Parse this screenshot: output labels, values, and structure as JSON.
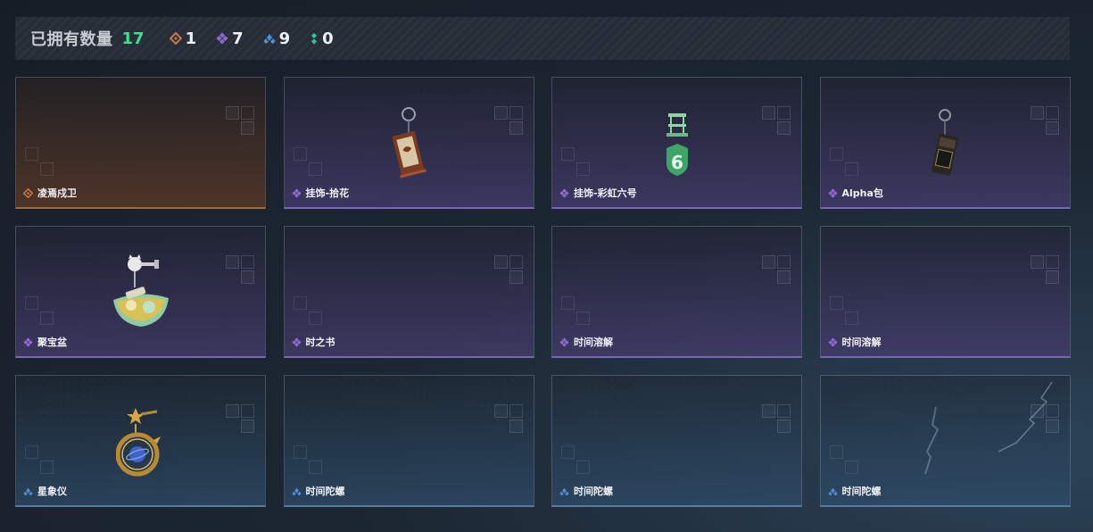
{
  "header": {
    "label": "已拥有数量",
    "total": "17",
    "counts": [
      {
        "rarity": "orange",
        "icon": "orange-diamond-icon",
        "color": "#c9764a",
        "value": "1"
      },
      {
        "rarity": "purple",
        "icon": "purple-cluster-icon",
        "color": "#8f6ad4",
        "value": "7"
      },
      {
        "rarity": "blue",
        "icon": "blue-triangle-icon",
        "color": "#4f8fd6",
        "value": "9"
      },
      {
        "rarity": "green",
        "icon": "green-dots-icon",
        "color": "#37c79a",
        "value": "0"
      }
    ]
  },
  "items": [
    {
      "name": "凌焉戍卫",
      "rarity": "orange",
      "art": "none"
    },
    {
      "name": "挂饰-拾花",
      "rarity": "purple",
      "art": "charm-scroll"
    },
    {
      "name": "挂饰-彩虹六号",
      "rarity": "purple",
      "art": "charm-six"
    },
    {
      "name": "Alpha包",
      "rarity": "purple",
      "art": "charm-pouch"
    },
    {
      "name": "聚宝盆",
      "rarity": "purple",
      "art": "treasure-bowl"
    },
    {
      "name": "时之书",
      "rarity": "purple",
      "art": "none"
    },
    {
      "name": "时间溶解",
      "rarity": "purple",
      "art": "none"
    },
    {
      "name": "时间溶解",
      "rarity": "purple",
      "art": "none"
    },
    {
      "name": "星象仪",
      "rarity": "blue",
      "art": "astrolabe"
    },
    {
      "name": "时间陀螺",
      "rarity": "blue",
      "art": "none"
    },
    {
      "name": "时间陀螺",
      "rarity": "blue",
      "art": "none"
    },
    {
      "name": "时间陀螺",
      "rarity": "blue",
      "art": "none"
    }
  ],
  "colors": {
    "total_green": "#3fe08a",
    "orange": "#c9764a",
    "purple": "#8f6ad4",
    "blue": "#4f8fd6"
  }
}
